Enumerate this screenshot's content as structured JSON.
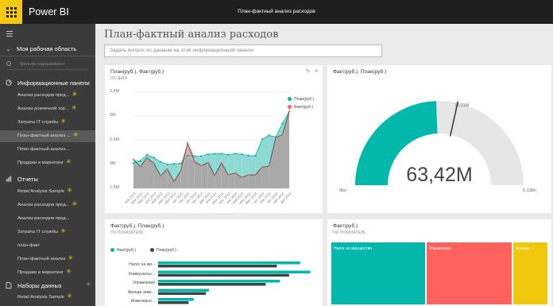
{
  "app": {
    "brand": "Power BI",
    "report_title": "План-фактный анализ расходов"
  },
  "sidebar": {
    "workspace": "Моя рабочая область",
    "filter_placeholder": "Фильтр содержимого",
    "sections": {
      "dashboards": {
        "label": "Информационные панели",
        "items": [
          {
            "label": "Анализ расходов пред...",
            "star": true
          },
          {
            "label": "Анализ розничной тор...",
            "star": true
          },
          {
            "label": "Затраты IT службы",
            "star": true
          },
          {
            "label": "План-фактный анализ ...",
            "star": true
          },
          {
            "label": "План-фактный анализ...",
            "star": false
          },
          {
            "label": "Продажи и маркетинг",
            "star": true
          }
        ]
      },
      "reports": {
        "label": "Отчеты",
        "items": [
          {
            "label": "Retail Analysis Sample",
            "star": true
          },
          {
            "label": "Анализ расходов пред...",
            "star": true
          },
          {
            "label": "Анализ расходов пред...",
            "star": false
          },
          {
            "label": "Затраты IT службы",
            "star": true
          },
          {
            "label": "план-факт",
            "star": false
          },
          {
            "label": "План-фактный анализ",
            "star": true
          },
          {
            "label": "Продажи и маркетинг",
            "star": true
          }
        ]
      },
      "datasets": {
        "label": "Наборы данных",
        "items": [
          {
            "label": "Retail Analysis Sample",
            "star": true
          }
        ]
      }
    }
  },
  "main": {
    "title": "План-фактный анализ расходов",
    "qa_placeholder": "Задать вопрос по данным на этой информационной панели"
  },
  "tiles": {
    "line": {
      "title": "План(руб.), Факт(руб.)",
      "subtitle": "ПО ДАТА"
    },
    "gauge": {
      "title": "Факт(руб.), План(руб.)",
      "value": "63,42M",
      "min": "0bn",
      "max": "0,13bn",
      "target": "72,21M",
      "target_fraction": 0.5694
    },
    "bar": {
      "title": "Факт(руб.), План(руб.)",
      "subtitle": "ПО ПОКАЗАТЕЛЬ"
    },
    "treemap": {
      "title": "Факт(руб.)",
      "subtitle": "ПО ПОКАЗАТЕЛЬ",
      "cells": [
        {
          "label": "Налог на имущество",
          "color": "#01b8aa"
        },
        {
          "label": "Управление",
          "color": "#fd625e"
        },
        {
          "label": "Аренда ...",
          "color": "#f2c80f"
        }
      ]
    }
  },
  "colors": {
    "plan": "#01b8aa",
    "fact": "#fd625e",
    "fact_bar": "#374649",
    "brand": "#f2c811"
  },
  "chart_data": [
    {
      "type": "area",
      "title": "План(руб.), Факт(руб.)",
      "yticks": [
        "1,5M",
        "2M",
        "2,5M",
        "3M",
        "3,5M"
      ],
      "ylim": [
        1500000,
        3500000
      ],
      "x": [
        "янв 2013",
        "фев 2013",
        "мар 2013",
        "апр 2013",
        "май 2013",
        "июн 2013",
        "июл 2013",
        "авг 2013",
        "сен 2013",
        "окт 2013",
        "ноя 2013",
        "дек 2013",
        "янв 2014",
        "фев 2014",
        "мар 2014",
        "апр 2014",
        "май 2014",
        "июн 2014",
        "июл 2014",
        "авг 2014",
        "сен 2014",
        "окт 2014",
        "ноя 2014",
        "дек 2014"
      ],
      "legend": "top-right",
      "series": [
        {
          "name": "План(руб.)",
          "values": [
            2020000,
            2070000,
            2200000,
            2140000,
            2050000,
            2000000,
            2010000,
            2020000,
            2180000,
            2170000,
            2170000,
            2210000,
            2220000,
            2220000,
            2200000,
            2220000,
            2210000,
            2180000,
            2180000,
            2520000,
            2600000,
            2570000,
            2850000,
            3100000
          ]
        },
        {
          "name": "Факт(руб.)",
          "values": [
            2100000,
            1950000,
            2140000,
            2020000,
            1760000,
            1900000,
            1640000,
            1870000,
            2440000,
            2060000,
            1970000,
            2040000,
            1770000,
            2030000,
            1780000,
            1820000,
            1730000,
            1780000,
            1780000,
            1940000,
            1960000,
            2550000,
            2620000,
            3100000
          ]
        }
      ]
    },
    {
      "type": "bar",
      "orientation": "horizontal",
      "title": "Факт(руб.), План(руб.)",
      "categories": [
        "Налог на им...",
        "Коммунальн...",
        "Управление",
        "Аренда земе...",
        "Инженерно..."
      ],
      "legend": "top-left",
      "series": [
        {
          "name": "Факт(руб.)",
          "values": [
            14000000,
            15000000,
            12000000,
            5000000,
            3500000
          ]
        },
        {
          "name": "План(руб.)",
          "values": [
            11700000,
            12900000,
            10600000,
            4700000,
            3000000
          ]
        }
      ],
      "xlim": [
        0,
        15500000
      ]
    }
  ]
}
